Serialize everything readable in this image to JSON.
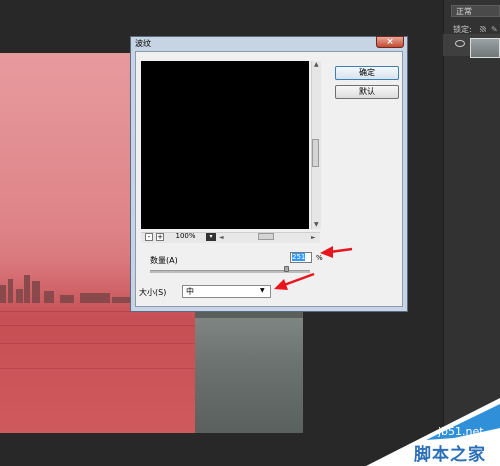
{
  "dialog": {
    "title": "波纹",
    "close_glyph": "×",
    "ok_label": "确定",
    "default_label": "默认",
    "zoom": {
      "minus": "-",
      "plus": "+",
      "value": "100%",
      "drop": "▾"
    },
    "amount": {
      "label": "数量(A)",
      "value": "251",
      "unit": "%",
      "level_percent": 85
    },
    "size": {
      "label": "大小(S)",
      "value": "中"
    }
  },
  "panel": {
    "blend_mode": "正常",
    "lock_label": "锁定:"
  },
  "watermark": {
    "site": "jb51.net",
    "brand": "脚本之家"
  },
  "colors": {
    "annotation_arrow": "#e8151d",
    "dialog_frame": "#c6d4e4",
    "ok_border": "#3c7fb1"
  },
  "icons": [
    "close-icon",
    "zoom-minus-icon",
    "zoom-plus-icon",
    "dropdown-icon",
    "eye-icon",
    "lock-pixels-icon",
    "lock-brush-icon"
  ]
}
